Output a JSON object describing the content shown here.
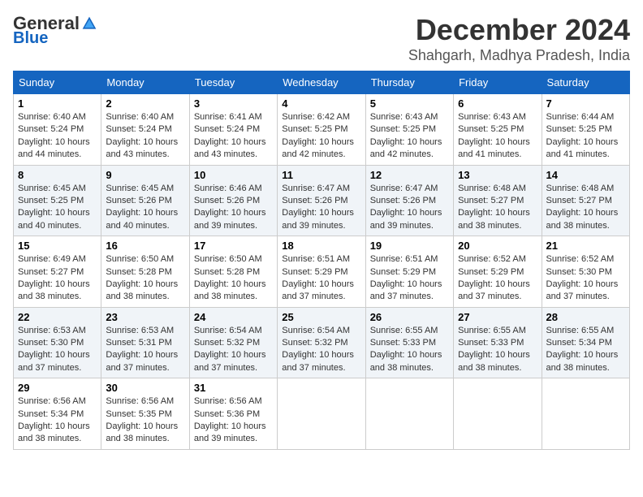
{
  "header": {
    "logo": {
      "general": "General",
      "blue": "Blue"
    },
    "title": "December 2024",
    "subtitle": "Shahgarh, Madhya Pradesh, India"
  },
  "calendar": {
    "days_of_week": [
      "Sunday",
      "Monday",
      "Tuesday",
      "Wednesday",
      "Thursday",
      "Friday",
      "Saturday"
    ],
    "weeks": [
      [
        null,
        {
          "day": "2",
          "sunrise": "6:40 AM",
          "sunset": "5:24 PM",
          "daylight": "10 hours and 43 minutes."
        },
        {
          "day": "3",
          "sunrise": "6:41 AM",
          "sunset": "5:24 PM",
          "daylight": "10 hours and 43 minutes."
        },
        {
          "day": "4",
          "sunrise": "6:42 AM",
          "sunset": "5:25 PM",
          "daylight": "10 hours and 42 minutes."
        },
        {
          "day": "5",
          "sunrise": "6:43 AM",
          "sunset": "5:25 PM",
          "daylight": "10 hours and 42 minutes."
        },
        {
          "day": "6",
          "sunrise": "6:43 AM",
          "sunset": "5:25 PM",
          "daylight": "10 hours and 41 minutes."
        },
        {
          "day": "7",
          "sunrise": "6:44 AM",
          "sunset": "5:25 PM",
          "daylight": "10 hours and 41 minutes."
        }
      ],
      [
        {
          "day": "1",
          "sunrise": "6:40 AM",
          "sunset": "5:24 PM",
          "daylight": "10 hours and 44 minutes."
        },
        null,
        null,
        null,
        null,
        null,
        null
      ],
      [
        {
          "day": "8",
          "sunrise": "6:45 AM",
          "sunset": "5:25 PM",
          "daylight": "10 hours and 40 minutes."
        },
        {
          "day": "9",
          "sunrise": "6:45 AM",
          "sunset": "5:26 PM",
          "daylight": "10 hours and 40 minutes."
        },
        {
          "day": "10",
          "sunrise": "6:46 AM",
          "sunset": "5:26 PM",
          "daylight": "10 hours and 39 minutes."
        },
        {
          "day": "11",
          "sunrise": "6:47 AM",
          "sunset": "5:26 PM",
          "daylight": "10 hours and 39 minutes."
        },
        {
          "day": "12",
          "sunrise": "6:47 AM",
          "sunset": "5:26 PM",
          "daylight": "10 hours and 39 minutes."
        },
        {
          "day": "13",
          "sunrise": "6:48 AM",
          "sunset": "5:27 PM",
          "daylight": "10 hours and 38 minutes."
        },
        {
          "day": "14",
          "sunrise": "6:48 AM",
          "sunset": "5:27 PM",
          "daylight": "10 hours and 38 minutes."
        }
      ],
      [
        {
          "day": "15",
          "sunrise": "6:49 AM",
          "sunset": "5:27 PM",
          "daylight": "10 hours and 38 minutes."
        },
        {
          "day": "16",
          "sunrise": "6:50 AM",
          "sunset": "5:28 PM",
          "daylight": "10 hours and 38 minutes."
        },
        {
          "day": "17",
          "sunrise": "6:50 AM",
          "sunset": "5:28 PM",
          "daylight": "10 hours and 38 minutes."
        },
        {
          "day": "18",
          "sunrise": "6:51 AM",
          "sunset": "5:29 PM",
          "daylight": "10 hours and 37 minutes."
        },
        {
          "day": "19",
          "sunrise": "6:51 AM",
          "sunset": "5:29 PM",
          "daylight": "10 hours and 37 minutes."
        },
        {
          "day": "20",
          "sunrise": "6:52 AM",
          "sunset": "5:29 PM",
          "daylight": "10 hours and 37 minutes."
        },
        {
          "day": "21",
          "sunrise": "6:52 AM",
          "sunset": "5:30 PM",
          "daylight": "10 hours and 37 minutes."
        }
      ],
      [
        {
          "day": "22",
          "sunrise": "6:53 AM",
          "sunset": "5:30 PM",
          "daylight": "10 hours and 37 minutes."
        },
        {
          "day": "23",
          "sunrise": "6:53 AM",
          "sunset": "5:31 PM",
          "daylight": "10 hours and 37 minutes."
        },
        {
          "day": "24",
          "sunrise": "6:54 AM",
          "sunset": "5:32 PM",
          "daylight": "10 hours and 37 minutes."
        },
        {
          "day": "25",
          "sunrise": "6:54 AM",
          "sunset": "5:32 PM",
          "daylight": "10 hours and 37 minutes."
        },
        {
          "day": "26",
          "sunrise": "6:55 AM",
          "sunset": "5:33 PM",
          "daylight": "10 hours and 38 minutes."
        },
        {
          "day": "27",
          "sunrise": "6:55 AM",
          "sunset": "5:33 PM",
          "daylight": "10 hours and 38 minutes."
        },
        {
          "day": "28",
          "sunrise": "6:55 AM",
          "sunset": "5:34 PM",
          "daylight": "10 hours and 38 minutes."
        }
      ],
      [
        {
          "day": "29",
          "sunrise": "6:56 AM",
          "sunset": "5:34 PM",
          "daylight": "10 hours and 38 minutes."
        },
        {
          "day": "30",
          "sunrise": "6:56 AM",
          "sunset": "5:35 PM",
          "daylight": "10 hours and 38 minutes."
        },
        {
          "day": "31",
          "sunrise": "6:56 AM",
          "sunset": "5:36 PM",
          "daylight": "10 hours and 39 minutes."
        },
        null,
        null,
        null,
        null
      ]
    ]
  }
}
